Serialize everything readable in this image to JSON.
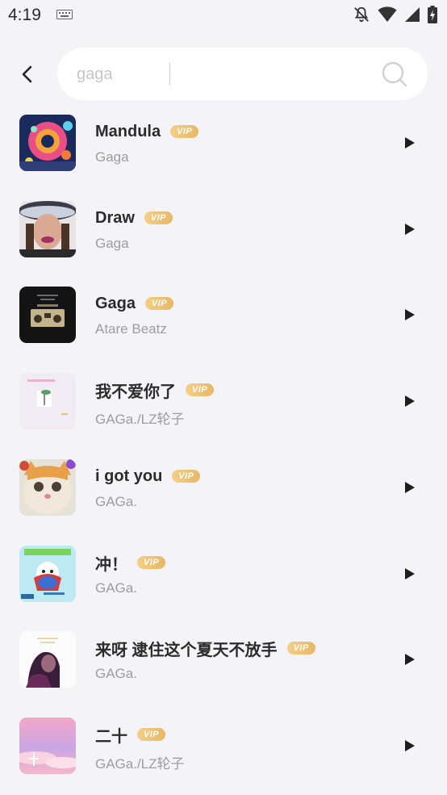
{
  "status_bar": {
    "time": "4:19",
    "icons": [
      "keyboard-icon",
      "notifications-off-icon",
      "wifi-icon",
      "cell-signal-icon",
      "battery-charging-icon"
    ]
  },
  "header": {
    "back_icon": "back-arrow-icon",
    "search": {
      "value": "gaga",
      "icon": "search-icon"
    }
  },
  "songs": [
    {
      "title": "Mandula",
      "artist": "Gaga",
      "badge": "VIP",
      "cover": "cover-mandula"
    },
    {
      "title": "Draw",
      "artist": "Gaga",
      "badge": "VIP",
      "cover": "cover-draw"
    },
    {
      "title": "Gaga",
      "artist": "Atare Beatz",
      "badge": "VIP",
      "cover": "cover-throwback-sounds"
    },
    {
      "title": "我不爱你了",
      "artist": "GAGa./LZ轮子",
      "badge": "VIP",
      "cover": "cover-pastel-tree"
    },
    {
      "title": "i got you",
      "artist": "GAGa.",
      "badge": "VIP",
      "cover": "cover-cat"
    },
    {
      "title": "冲！",
      "artist": "GAGa.",
      "badge": "VIP",
      "cover": "cover-cartoon-hero"
    },
    {
      "title": "来呀 逮住这个夏天不放手",
      "artist": "GAGa.",
      "badge": "VIP",
      "cover": "cover-portrait"
    },
    {
      "title": "二十",
      "artist": "GAGa./LZ轮子",
      "badge": "VIP",
      "cover": "cover-pink-sky"
    }
  ],
  "colors": {
    "background": "#f4f4f8",
    "title_text": "#2b2b2b",
    "secondary_text": "#9d9d9d",
    "vip_gold": "#e8b766"
  }
}
